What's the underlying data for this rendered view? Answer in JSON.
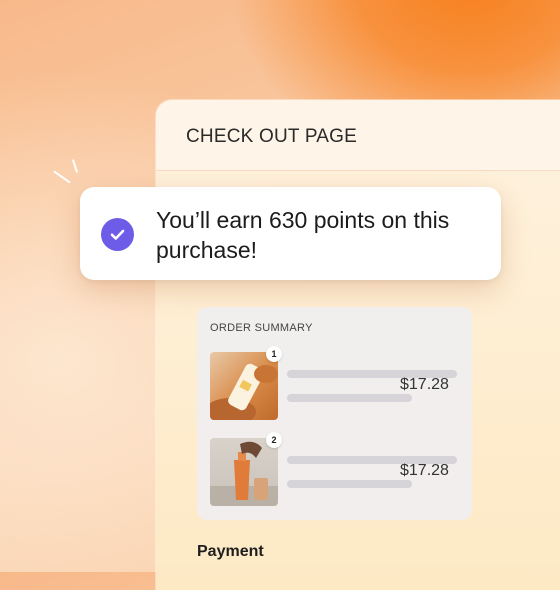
{
  "checkout": {
    "title": "CHECK OUT PAGE"
  },
  "toast": {
    "message": "You’ll earn 630 points on this purchase!",
    "icon": "check-circle-icon",
    "accent_color": "#6c5ce7"
  },
  "order_summary": {
    "label": "ORDER SUMMARY",
    "items": [
      {
        "quantity": "1",
        "price": "$17.28",
        "image": "sunscreen-tube-product-image"
      },
      {
        "quantity": "2",
        "price": "$17.28",
        "image": "orange-bottle-product-image"
      }
    ]
  },
  "payment": {
    "label": "Payment"
  }
}
